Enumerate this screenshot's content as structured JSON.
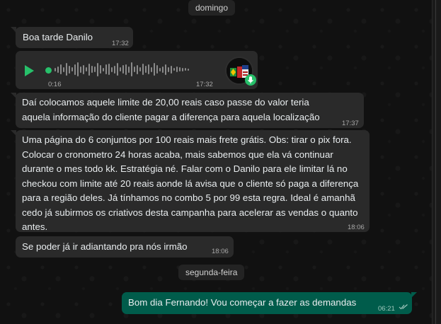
{
  "chat": {
    "dividers": [
      "domingo",
      "segunda-feira"
    ],
    "messages": [
      {
        "text": "Boa tarde Danilo",
        "time": "17:32"
      },
      {
        "audio": true,
        "duration": "0:16",
        "time": "17:32"
      },
      {
        "text": "Daí colocamos aquele limite de 20,00 reais caso passe do valor teria aquela informação do cliente pagar a diferença para aquela localização",
        "time": "17:37"
      },
      {
        "text": "Uma página do 6 conjuntos por 100 reais mais frete grátis. Obs: tirar o pix fora. Colocar o cronometro 24 horas acaba, mais sabemos que ela vá continuar durante o mes todo kk. Estratégia né.   Falar com o Danilo para ele limitar lá no checkou com limite até 20 reais aonde lá avisa que o cliente só paga a diferença para a região deles. Já tínhamos no combo 5 por 99 esta regra. Ideal é amanhã cedo já subirmos os criativos desta campanha para acelerar as vendas o quanto antes.",
        "time": "18:06"
      },
      {
        "text": "Se poder já ir adiantando pra nós irmão",
        "time": "18:06"
      },
      {
        "text": "Bom dia Fernando! Vou começar a fazer as demandas",
        "time": "06:21",
        "outgoing": true
      }
    ]
  },
  "colors": {
    "incoming": "#2a2a2a",
    "outgoing": "#005c4b",
    "accent": "#27c06a"
  },
  "icons": [
    "play-icon",
    "mic-icon",
    "double-check-icon"
  ]
}
